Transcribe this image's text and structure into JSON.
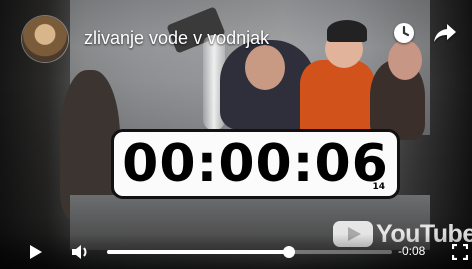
{
  "video": {
    "title": "zlivanje vode v vodnjak",
    "timer_display": "00:00:06",
    "timer_frames": "14"
  },
  "top_bar": {
    "channel_avatar_icon": "channel-avatar",
    "watch_later_icon": "clock-icon",
    "share_icon": "share-arrow-icon"
  },
  "watermark": {
    "text": "YouTube"
  },
  "controls": {
    "play_icon": "play-icon",
    "volume_icon": "volume-icon",
    "fullscreen_icon": "fullscreen-icon",
    "progress_fraction": 0.64,
    "time_remaining": "-0:08"
  },
  "colors": {
    "player_bg": "#0f0f0f",
    "timer_bg": "#fbfbfb",
    "timer_text": "#000000"
  }
}
